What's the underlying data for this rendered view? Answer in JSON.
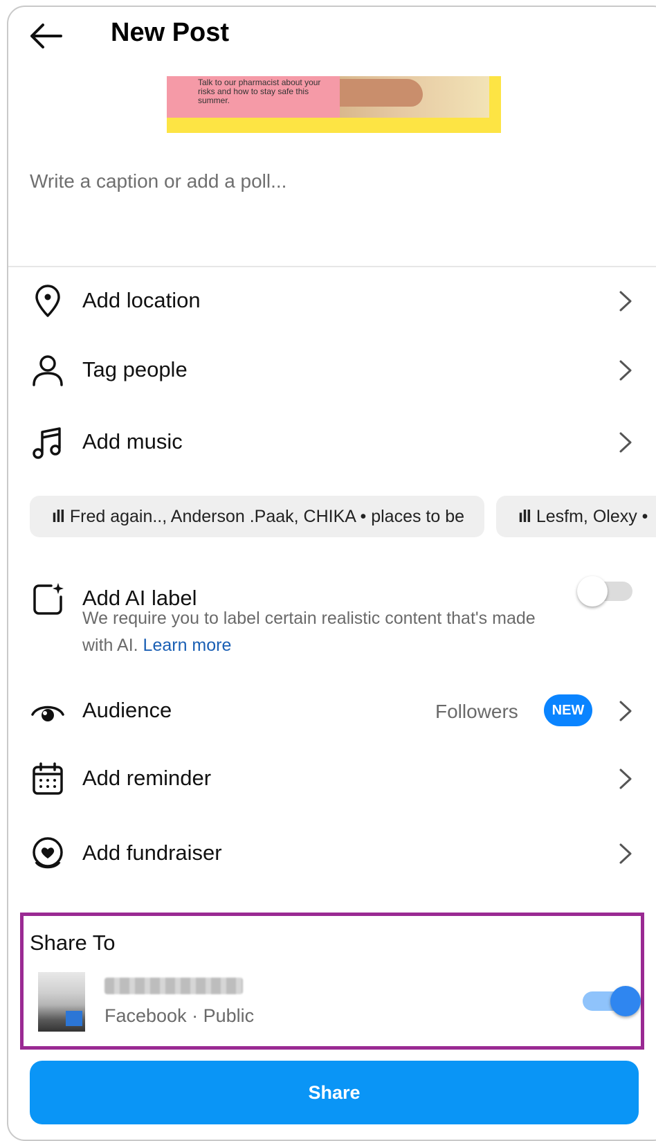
{
  "header": {
    "title": "New Post"
  },
  "media": {
    "ad_text": "Talk to our pharmacist about your risks and how to stay safe this summer."
  },
  "caption": {
    "placeholder": "Write a caption or add a poll..."
  },
  "options": {
    "location": "Add location",
    "tag_people": "Tag people",
    "music": "Add music",
    "ai_label": "Add AI label",
    "ai_desc": "We require you to label certain realistic content that's made with AI.",
    "ai_link": "Learn more",
    "ai_toggle_on": false,
    "audience": "Audience",
    "audience_value": "Followers",
    "audience_badge": "NEW",
    "reminder": "Add reminder",
    "fundraiser": "Add fundraiser"
  },
  "music_suggestions": [
    "Fred again.., Anderson .Paak, CHIKA • places to be",
    "Lesfm, Olexy •"
  ],
  "share_to": {
    "title": "Share To",
    "account_subtitle": "Facebook · Public",
    "toggle_on": true
  },
  "share_button": "Share",
  "colors": {
    "primary": "#0a95f6",
    "highlight_box": "#9a2a93",
    "link": "#1a5fb4"
  }
}
